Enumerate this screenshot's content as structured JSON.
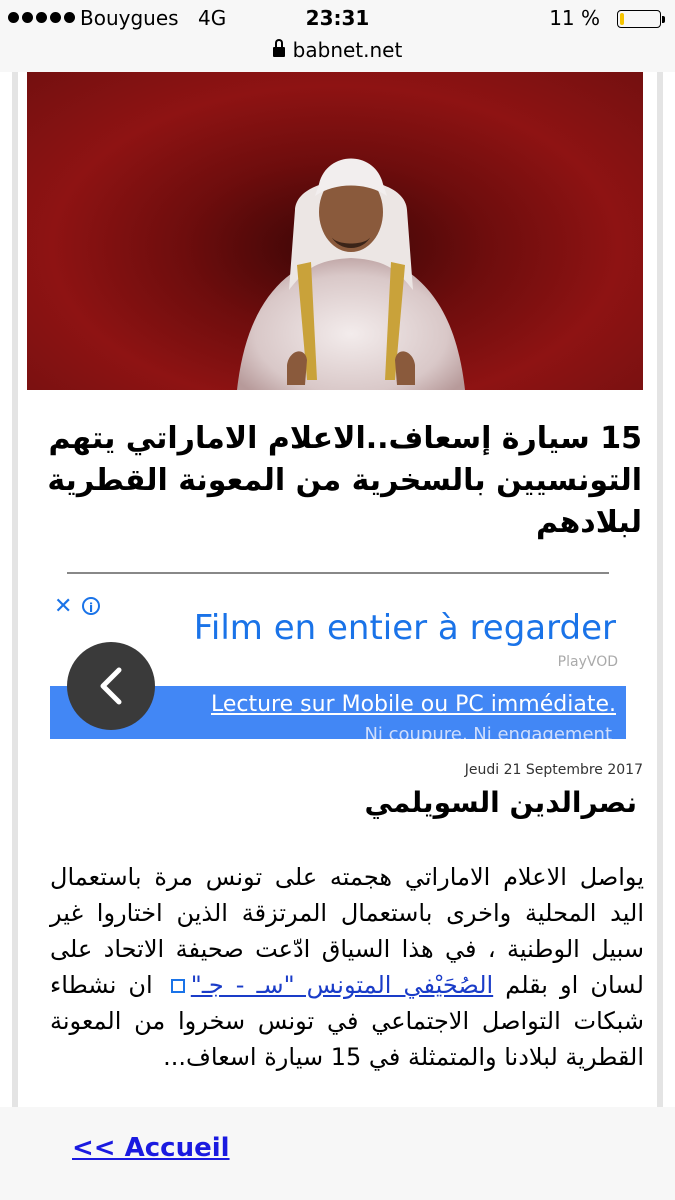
{
  "status_bar": {
    "carrier": "Bouygues",
    "network": "4G",
    "time": "23:31",
    "battery_percent_label": "11 %",
    "battery_level": 0.11
  },
  "url_bar": {
    "domain": "babnet.net"
  },
  "article": {
    "headline": "15 سيارة إسعاف..الاعلام الاماراتي يتهم التونسيين بالسخرية من المعونة القطرية لبلادهم",
    "date": "Jeudi 21 Septembre 2017",
    "author": "نصرالدين السويلمي",
    "body": {
      "part1": "يواصل الاعلام الاماراتي هجمته على تونس مرة باستعمال اليد المحلية واخرى باستعمال المرتزقة الذين اختاروا غير سبيل الوطنية ، في هذا السياق ادّعت صحيفة الاتحاد على لسان او بقلم",
      "link1": "الصُحَيْفي المتونس \"سـ - جـ\"",
      "part2": "ان نشطاء شبكات التواصل الاجتماعي في تونس سخروا من المعونة القطرية لبلادنا والمتمثلة في 15 سيارة اسعاف..."
    }
  },
  "ad": {
    "title": "Film en entier à regarder",
    "brand": "PlayVOD",
    "cta": "Lecture sur Mobile ou PC immédiate.",
    "sub": "Ni coupure, Ni engagement",
    "close_glyph": "✕",
    "info_glyph": "i"
  },
  "bottom_bar": {
    "home_link": "<< Accueil"
  },
  "colors": {
    "accent": "#1a73e8",
    "ad_blue": "#4287f5",
    "hero_red": "#8e1313"
  }
}
